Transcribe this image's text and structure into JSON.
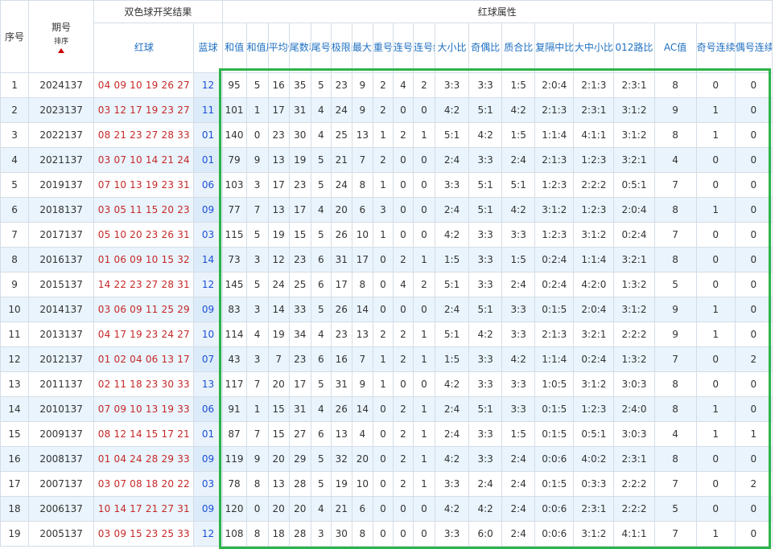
{
  "header": {
    "seq_label": "序号",
    "period_label": "期号",
    "sort_label": "排序",
    "result_group": "双色球开奖结果",
    "red_label": "红球",
    "blue_label": "蓝球",
    "attr_group": "红球属性",
    "attr_cols": [
      "和值",
      "和值尾数",
      "平均值",
      "尾数和值",
      "尾号组数",
      "极限间距",
      "最大间距",
      "重号个数",
      "连号个数",
      "连号组数",
      "大小比",
      "奇偶比",
      "质合比",
      "复隔中比",
      "大中小比",
      "012路比",
      "AC值",
      "奇号连续",
      "偶号连续"
    ]
  },
  "rows": [
    {
      "seq": "1",
      "period": "2024137",
      "red": "04 09 10 19 26 27",
      "blue": "12",
      "attrs": [
        "95",
        "5",
        "16",
        "35",
        "5",
        "23",
        "9",
        "2",
        "4",
        "2",
        "3:3",
        "3:3",
        "1:5",
        "2:0:4",
        "2:1:3",
        "2:3:1",
        "8",
        "0",
        "0"
      ]
    },
    {
      "seq": "2",
      "period": "2023137",
      "red": "03 12 17 19 23 27",
      "blue": "11",
      "attrs": [
        "101",
        "1",
        "17",
        "31",
        "4",
        "24",
        "9",
        "2",
        "0",
        "0",
        "4:2",
        "5:1",
        "4:2",
        "2:1:3",
        "2:3:1",
        "3:1:2",
        "9",
        "1",
        "0"
      ]
    },
    {
      "seq": "3",
      "period": "2022137",
      "red": "08 21 23 27 28 33",
      "blue": "01",
      "attrs": [
        "140",
        "0",
        "23",
        "30",
        "4",
        "25",
        "13",
        "1",
        "2",
        "1",
        "5:1",
        "4:2",
        "1:5",
        "1:1:4",
        "4:1:1",
        "3:1:2",
        "8",
        "1",
        "0"
      ]
    },
    {
      "seq": "4",
      "period": "2021137",
      "red": "03 07 10 14 21 24",
      "blue": "01",
      "attrs": [
        "79",
        "9",
        "13",
        "19",
        "5",
        "21",
        "7",
        "2",
        "0",
        "0",
        "2:4",
        "3:3",
        "2:4",
        "2:1:3",
        "1:2:3",
        "3:2:1",
        "4",
        "0",
        "0"
      ]
    },
    {
      "seq": "5",
      "period": "2019137",
      "red": "07 10 13 19 23 31",
      "blue": "06",
      "attrs": [
        "103",
        "3",
        "17",
        "23",
        "5",
        "24",
        "8",
        "1",
        "0",
        "0",
        "3:3",
        "5:1",
        "5:1",
        "1:2:3",
        "2:2:2",
        "0:5:1",
        "7",
        "0",
        "0"
      ]
    },
    {
      "seq": "6",
      "period": "2018137",
      "red": "03 05 11 15 20 23",
      "blue": "09",
      "attrs": [
        "77",
        "7",
        "13",
        "17",
        "4",
        "20",
        "6",
        "3",
        "0",
        "0",
        "2:4",
        "5:1",
        "4:2",
        "3:1:2",
        "1:2:3",
        "2:0:4",
        "8",
        "1",
        "0"
      ]
    },
    {
      "seq": "7",
      "period": "2017137",
      "red": "05 10 20 23 26 31",
      "blue": "03",
      "attrs": [
        "115",
        "5",
        "19",
        "15",
        "5",
        "26",
        "10",
        "1",
        "0",
        "0",
        "4:2",
        "3:3",
        "3:3",
        "1:2:3",
        "3:1:2",
        "0:2:4",
        "7",
        "0",
        "0"
      ]
    },
    {
      "seq": "8",
      "period": "2016137",
      "red": "01 06 09 10 15 32",
      "blue": "14",
      "attrs": [
        "73",
        "3",
        "12",
        "23",
        "6",
        "31",
        "17",
        "0",
        "2",
        "1",
        "1:5",
        "3:3",
        "1:5",
        "0:2:4",
        "1:1:4",
        "3:2:1",
        "8",
        "0",
        "0"
      ]
    },
    {
      "seq": "9",
      "period": "2015137",
      "red": "14 22 23 27 28 31",
      "blue": "12",
      "attrs": [
        "145",
        "5",
        "24",
        "25",
        "6",
        "17",
        "8",
        "0",
        "4",
        "2",
        "5:1",
        "3:3",
        "2:4",
        "0:2:4",
        "4:2:0",
        "1:3:2",
        "5",
        "0",
        "0"
      ]
    },
    {
      "seq": "10",
      "period": "2014137",
      "red": "03 06 09 11 25 29",
      "blue": "09",
      "attrs": [
        "83",
        "3",
        "14",
        "33",
        "5",
        "26",
        "14",
        "0",
        "0",
        "0",
        "2:4",
        "5:1",
        "3:3",
        "0:1:5",
        "2:0:4",
        "3:1:2",
        "9",
        "1",
        "0"
      ]
    },
    {
      "seq": "11",
      "period": "2013137",
      "red": "04 17 19 23 24 27",
      "blue": "10",
      "attrs": [
        "114",
        "4",
        "19",
        "34",
        "4",
        "23",
        "13",
        "2",
        "2",
        "1",
        "5:1",
        "4:2",
        "3:3",
        "2:1:3",
        "3:2:1",
        "2:2:2",
        "9",
        "1",
        "0"
      ]
    },
    {
      "seq": "12",
      "period": "2012137",
      "red": "01 02 04 06 13 17",
      "blue": "07",
      "attrs": [
        "43",
        "3",
        "7",
        "23",
        "6",
        "16",
        "7",
        "1",
        "2",
        "1",
        "1:5",
        "3:3",
        "4:2",
        "1:1:4",
        "0:2:4",
        "1:3:2",
        "7",
        "0",
        "2"
      ]
    },
    {
      "seq": "13",
      "period": "2011137",
      "red": "02 11 18 23 30 33",
      "blue": "13",
      "attrs": [
        "117",
        "7",
        "20",
        "17",
        "5",
        "31",
        "9",
        "1",
        "0",
        "0",
        "4:2",
        "3:3",
        "3:3",
        "1:0:5",
        "3:1:2",
        "3:0:3",
        "8",
        "0",
        "0"
      ]
    },
    {
      "seq": "14",
      "period": "2010137",
      "red": "07 09 10 13 19 33",
      "blue": "06",
      "attrs": [
        "91",
        "1",
        "15",
        "31",
        "4",
        "26",
        "14",
        "0",
        "2",
        "1",
        "2:4",
        "5:1",
        "3:3",
        "0:1:5",
        "1:2:3",
        "2:4:0",
        "8",
        "1",
        "0"
      ]
    },
    {
      "seq": "15",
      "period": "2009137",
      "red": "08 12 14 15 17 21",
      "blue": "01",
      "attrs": [
        "87",
        "7",
        "15",
        "27",
        "6",
        "13",
        "4",
        "0",
        "2",
        "1",
        "2:4",
        "3:3",
        "1:5",
        "0:1:5",
        "0:5:1",
        "3:0:3",
        "4",
        "1",
        "1"
      ]
    },
    {
      "seq": "16",
      "period": "2008137",
      "red": "01 04 24 28 29 33",
      "blue": "09",
      "attrs": [
        "119",
        "9",
        "20",
        "29",
        "5",
        "32",
        "20",
        "0",
        "2",
        "1",
        "4:2",
        "3:3",
        "2:4",
        "0:0:6",
        "4:0:2",
        "2:3:1",
        "8",
        "0",
        "0"
      ]
    },
    {
      "seq": "17",
      "period": "2007137",
      "red": "03 07 08 18 20 22",
      "blue": "03",
      "attrs": [
        "78",
        "8",
        "13",
        "28",
        "5",
        "19",
        "10",
        "0",
        "2",
        "1",
        "3:3",
        "2:4",
        "2:4",
        "0:1:5",
        "0:3:3",
        "2:2:2",
        "7",
        "0",
        "2"
      ]
    },
    {
      "seq": "18",
      "period": "2006137",
      "red": "10 14 17 21 27 31",
      "blue": "09",
      "attrs": [
        "120",
        "0",
        "20",
        "20",
        "4",
        "21",
        "6",
        "0",
        "0",
        "0",
        "4:2",
        "4:2",
        "2:4",
        "0:0:6",
        "2:3:1",
        "2:2:2",
        "5",
        "0",
        "0"
      ]
    },
    {
      "seq": "19",
      "period": "2005137",
      "red": "03 09 15 23 25 33",
      "blue": "12",
      "attrs": [
        "108",
        "8",
        "18",
        "28",
        "3",
        "30",
        "8",
        "0",
        "0",
        "0",
        "3:3",
        "6:0",
        "2:4",
        "0:0:6",
        "3:1:2",
        "4:1:1",
        "7",
        "1",
        "0"
      ]
    }
  ]
}
